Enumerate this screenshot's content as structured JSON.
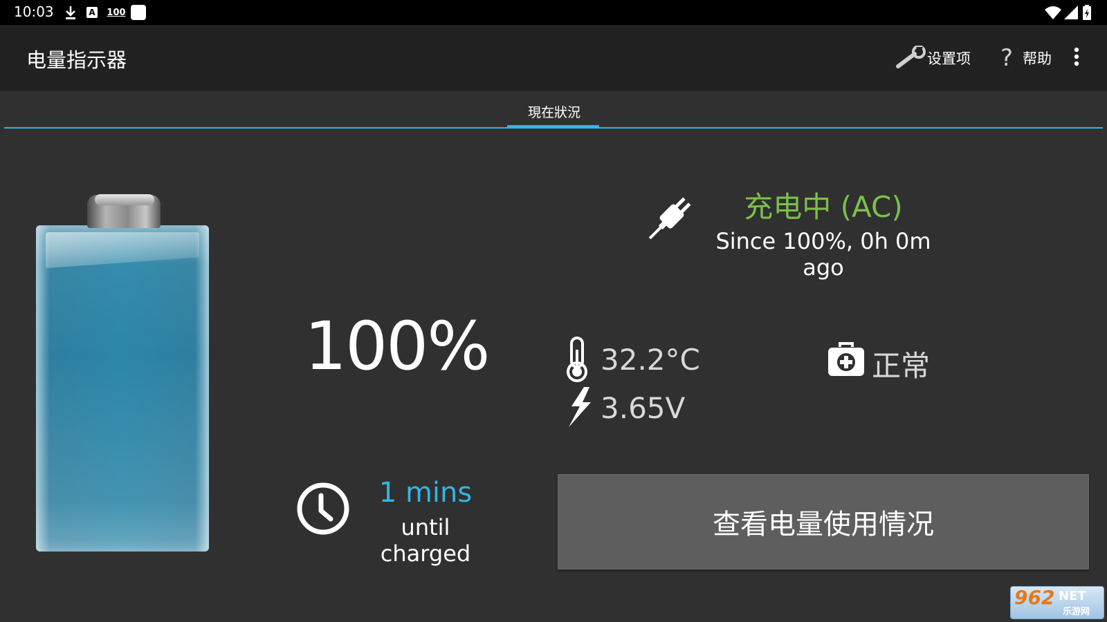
{
  "status_bar": {
    "time": "10:03",
    "icons": [
      "download-icon",
      "a-notification-icon",
      "signal-100-icon",
      "square-notification-icon",
      "wifi-icon",
      "cell-signal-icon",
      "battery-icon"
    ],
    "badge_100": "100",
    "badge_a": "A"
  },
  "app_bar": {
    "title": "电量指示器",
    "settings_label": "设置项",
    "help_label": "帮助",
    "help_glyph": "?"
  },
  "tabs": [
    {
      "label": "現在狀況",
      "selected": true
    }
  ],
  "battery": {
    "level": 1.0,
    "percent_text": "100%"
  },
  "charging": {
    "status": "充电中 (AC)",
    "since": "Since 100%, 0h 0m ago",
    "status_color": "#7cc04b"
  },
  "stats": {
    "temperature": "32.2°C",
    "voltage": "3.65V",
    "health": "正常"
  },
  "time_remaining": {
    "value": "1 mins",
    "label": "until charged",
    "value_color": "#33b5e5"
  },
  "usage_button": {
    "label": "查看电量使用情况"
  },
  "watermark": {
    "number": "962",
    "net": "NET",
    "sub": "乐游网"
  },
  "colors": {
    "accent": "#33b5e5",
    "background": "#303030",
    "app_bar": "#212121"
  }
}
